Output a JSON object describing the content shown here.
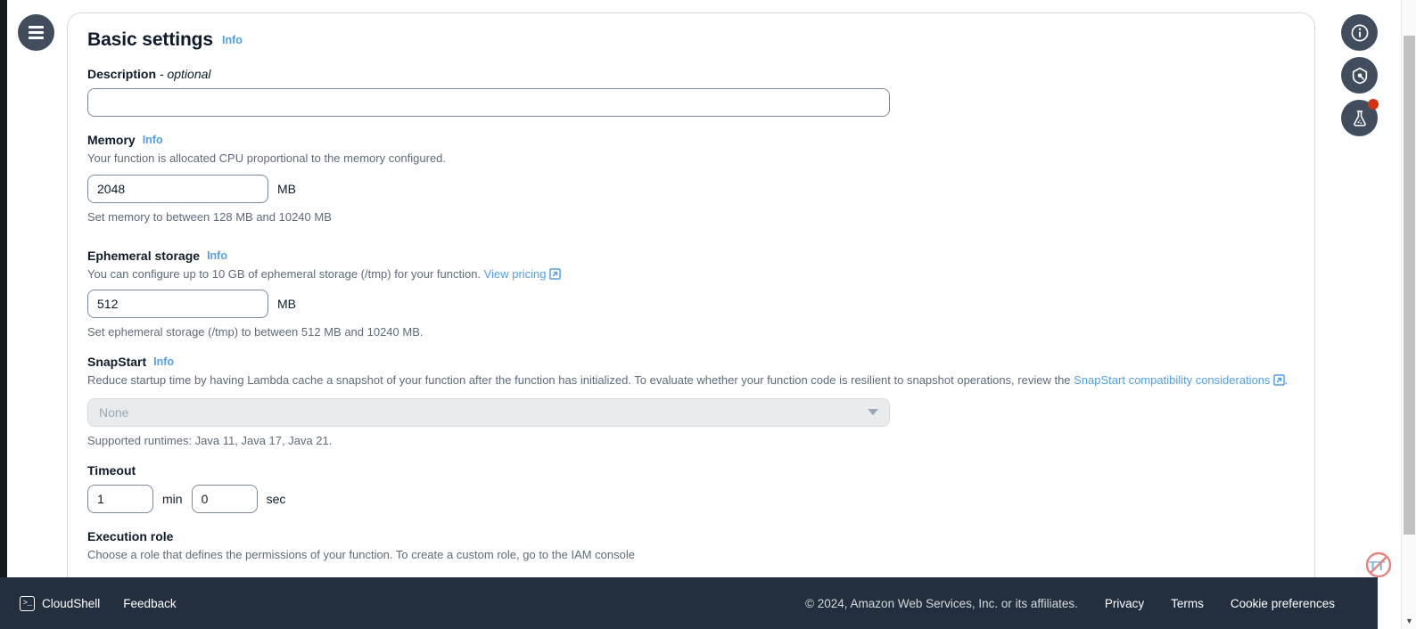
{
  "header": {
    "menu_icon": "hamburger-menu-icon"
  },
  "section": {
    "title": "Basic settings",
    "info_label": "Info"
  },
  "fields": {
    "description": {
      "label": "Description",
      "optional_suffix": "- optional",
      "value": "",
      "placeholder": ""
    },
    "memory": {
      "label": "Memory",
      "info_label": "Info",
      "description": "Your function is allocated CPU proportional to the memory configured.",
      "value": "2048",
      "unit": "MB",
      "helper": "Set memory to between 128 MB and 10240 MB"
    },
    "ephemeral_storage": {
      "label": "Ephemeral storage",
      "info_label": "Info",
      "description_prefix": "You can configure up to 10 GB of ephemeral storage (/tmp) for your function. ",
      "pricing_link": "View pricing",
      "value": "512",
      "unit": "MB",
      "helper": "Set ephemeral storage (/tmp) to between 512 MB and 10240 MB."
    },
    "snapstart": {
      "label": "SnapStart",
      "info_label": "Info",
      "description_prefix": "Reduce startup time by having Lambda cache a snapshot of your function after the function has initialized. To evaluate whether your function code is resilient to snapshot operations, review the ",
      "doc_link": "SnapStart compatibility considerations",
      "description_suffix": ".",
      "selected_option": "None",
      "options": [
        "None"
      ],
      "disabled": true,
      "helper": "Supported runtimes: Java 11, Java 17, Java 21."
    },
    "timeout": {
      "label": "Timeout",
      "minutes_value": "1",
      "minutes_unit": "min",
      "seconds_value": "0",
      "seconds_unit": "sec"
    },
    "execution_role": {
      "label": "Execution role",
      "description": "Choose a role that defines the permissions of your function. To create a custom role, go to the IAM console"
    }
  },
  "rail": {
    "buttons": [
      {
        "icon": "info-circle-icon",
        "has_badge": false
      },
      {
        "icon": "shield-icon",
        "has_badge": false
      },
      {
        "icon": "flask-icon",
        "has_badge": true
      }
    ]
  },
  "badge": {
    "icon": "no-text-to-speech-icon"
  },
  "footer": {
    "cloudshell_label": "CloudShell",
    "cloudshell_icon": "terminal-icon",
    "feedback_label": "Feedback",
    "copyright": "© 2024, Amazon Web Services, Inc. or its affiliates.",
    "privacy_label": "Privacy",
    "terms_label": "Terms",
    "cookie_label": "Cookie preferences"
  },
  "colors": {
    "link_blue": "#539fe5",
    "header_dark": "#232f3e",
    "rail_dark": "#414d5c",
    "badge_red": "#d13212"
  }
}
